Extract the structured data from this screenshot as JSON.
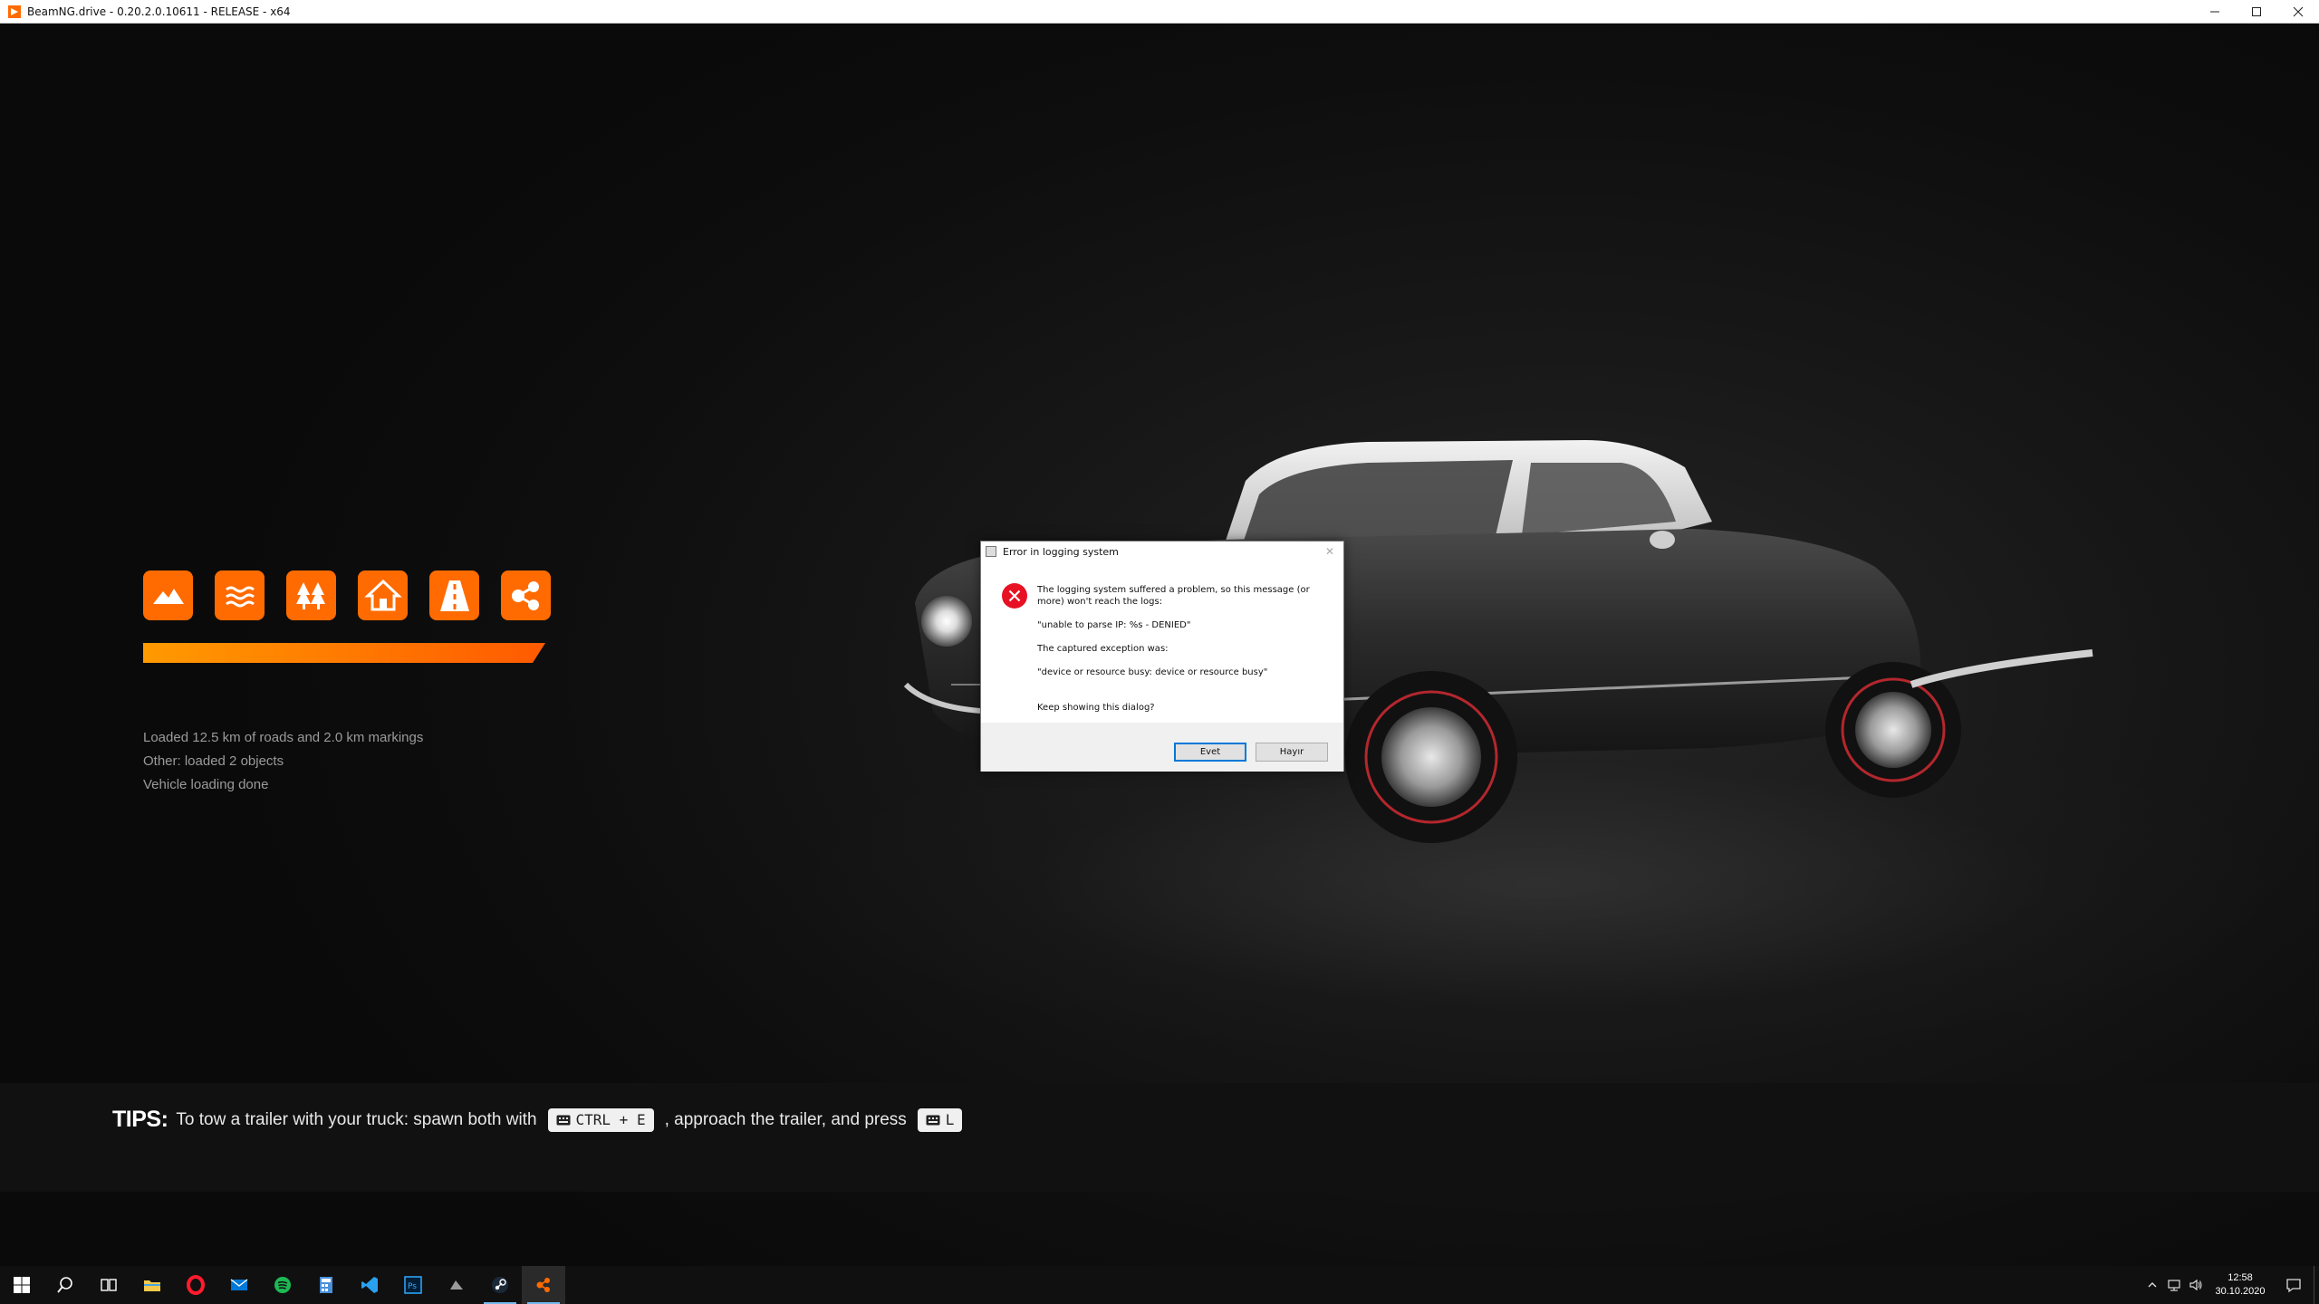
{
  "window": {
    "title": "BeamNG.drive - 0.20.2.0.10611 - RELEASE - x64",
    "controls": [
      "minimize-icon",
      "maximize-icon",
      "close-icon"
    ]
  },
  "loading": {
    "level_icons": [
      "mountain-icon",
      "water-icon",
      "trees-icon",
      "house-icon",
      "road-icon",
      "share-nodes-icon"
    ],
    "progress": 1.0,
    "log_lines": [
      "Loaded 12.5 km of roads and 2.0 km markings",
      "Other: loaded 2 objects",
      "Vehicle loading done"
    ]
  },
  "tips": {
    "label": "TIPS:",
    "text_1": "To tow a trailer with your truck: spawn both with",
    "key_1": "CTRL + E",
    "text_2": ", approach the trailer, and press",
    "key_2": "L"
  },
  "dialog": {
    "title": "Error in logging system",
    "close": "✕",
    "message_1": "The logging system suffered a problem, so this message (or more) won't reach the logs:",
    "message_2": "\"unable to parse IP: %s - DENIED\"",
    "message_3": "The captured exception was:",
    "message_4": "\"device or resource busy: device or resource busy\"",
    "message_5": "Keep showing this dialog?",
    "yes_label": "Evet",
    "no_label": "Hayır"
  },
  "taskbar": {
    "apps": [
      "start-icon",
      "search-icon",
      "task-view-icon",
      "file-explorer-icon",
      "opera-icon",
      "mail-icon",
      "spotify-icon",
      "calculator-icon",
      "vscode-icon",
      "photoshop-icon",
      "app-icon",
      "steam-icon",
      "beamng-icon"
    ],
    "clock_time": "12:58",
    "clock_date": "30.10.2020"
  },
  "colors": {
    "accent": "#ff6b00",
    "dialog_focus": "#0078d7",
    "error_red": "#e81123"
  }
}
